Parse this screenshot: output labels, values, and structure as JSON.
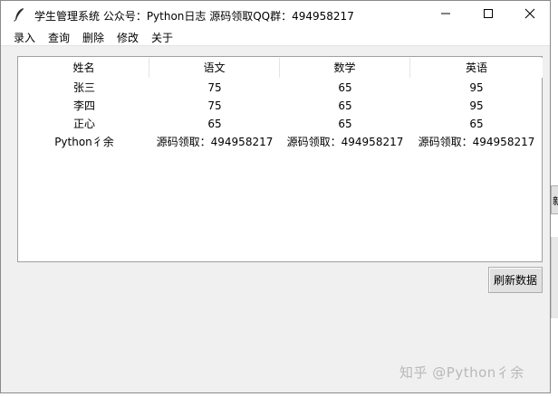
{
  "window": {
    "title": "学生管理系统 公众号：Python日志 源码领取QQ群：494958217"
  },
  "menu": [
    "录入",
    "查询",
    "删除",
    "修改",
    "关于"
  ],
  "table": {
    "columns": [
      "姓名",
      "语文",
      "数学",
      "英语"
    ],
    "rows": [
      [
        "张三",
        "75",
        "65",
        "95"
      ],
      [
        "李四",
        "75",
        "65",
        "95"
      ],
      [
        "正心",
        "65",
        "65",
        "65"
      ],
      [
        "Python彳余",
        "源码领取：494958217",
        "源码领取：494958217",
        "源码领取：494958217"
      ]
    ]
  },
  "buttons": {
    "refresh": "刷新数据"
  },
  "edge_widget": {
    "text": "新"
  },
  "watermark": "知乎 @Python彳余",
  "icons": {
    "app": "feather-icon",
    "minimize": "minimize-icon",
    "maximize": "maximize-icon",
    "close": "close-icon"
  }
}
